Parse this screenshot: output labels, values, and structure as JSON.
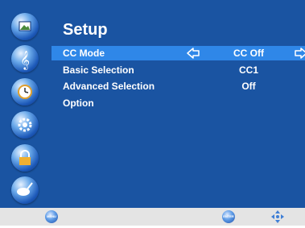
{
  "menu": {
    "title": "Setup",
    "sidebar_icons": [
      "picture-icon",
      "audio-icon",
      "clock-icon",
      "setup-icon",
      "lock-icon",
      "channel-icon"
    ],
    "rows": [
      {
        "label": "CC Mode",
        "value": "CC Off",
        "selected": true
      },
      {
        "label": "Basic Selection",
        "value": "CC1",
        "selected": false
      },
      {
        "label": "Advanced Selection",
        "value": "Off",
        "selected": false
      },
      {
        "label": "Option",
        "value": "",
        "selected": false
      }
    ]
  },
  "footer": {
    "menu_label": "MENU",
    "enter_label": "ENTER"
  },
  "colors": {
    "panel_bg": "#1a54a2",
    "selected_row": "#2f87e8",
    "footer_bg": "#e4e4e4"
  }
}
